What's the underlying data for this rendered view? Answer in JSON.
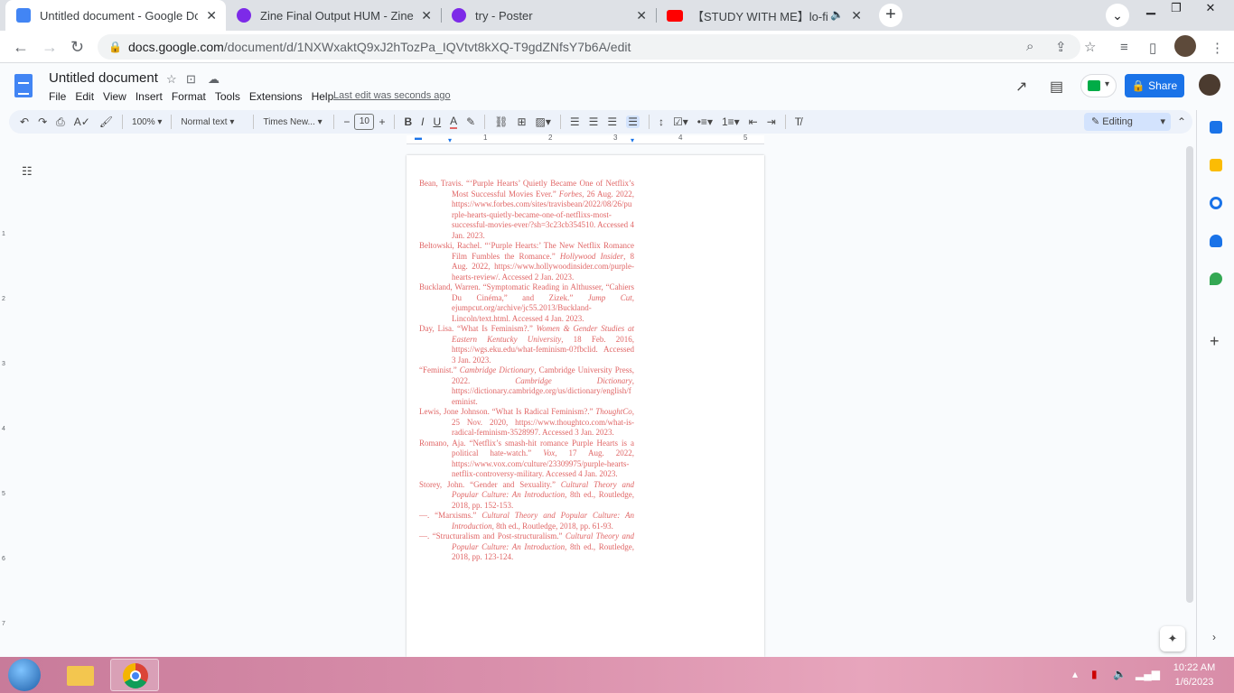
{
  "browser": {
    "tabs": [
      {
        "title": "Untitled document - Google Doc",
        "color": "#4285f4"
      },
      {
        "title": "Zine Final Output HUM - Zine",
        "color": "#7d2ae8"
      },
      {
        "title": "try - Poster",
        "color": "#7d2ae8"
      },
      {
        "title": "【STUDY WITH ME】lo-fi pe",
        "color": "#ff0000"
      }
    ],
    "url_host": "docs.google.com",
    "url_path": "/document/d/1NXWxaktQ9xJ2hTozPa_IQVtvt8kXQ-T9gdZNfsY7b6A/edit"
  },
  "doc": {
    "title": "Untitled document",
    "menu": [
      "File",
      "Edit",
      "View",
      "Insert",
      "Format",
      "Tools",
      "Extensions",
      "Help"
    ],
    "last_edit": "Last edit was seconds ago",
    "share_label": "Share"
  },
  "toolbar": {
    "zoom": "100%",
    "style": "Normal text",
    "font": "Times New...",
    "font_size": "10",
    "mode": "Editing"
  },
  "ruler": {
    "h_labels": [
      "1",
      "2",
      "3",
      "4",
      "5"
    ],
    "v_labels": [
      "1",
      "2",
      "3",
      "4",
      "5",
      "6",
      "7"
    ]
  },
  "references": [
    "Bean, Travis. “‘Purple Hearts’ Quietly Became One of Netflix’s Most Successful Movies Ever.” <i>Forbes</i>, 26 Aug. 2022, https://www.forbes.com/sites/travisbean/2022/08/26/purple-hearts-quietly-became-one-of-netflixs-most-successful-movies-ever/?sh=3c23cb354510. Accessed 4 Jan. 2023.",
    "Beltowski, Rachel. “‘Purple Hearts:’ The New Netflix Romance Film Fumbles the Romance.” <i>Hollywood Insider</i>, 8 Aug. 2022, https://www.hollywoodinsider.com/purple-hearts-review/. Accessed 2 Jan. 2023.",
    "Buckland, Warren. “Symptomatic Reading in Althusser, “Cahiers Du Cinéma,” and Zizek.” <i>Jump Cut</i>, ejumpcut.org/archive/jc55.2013/Buckland-Lincoln/text.html. Accessed 4 Jan. 2023.",
    "Day, Lisa. “What Is Feminism?.” <i>Women &amp; Gender Studies at Eastern Kentucky University</i>, 18 Feb. 2016, https://wgs.eku.edu/what-feminism-0?fbclid. Accessed 3 Jan. 2023.",
    "“Feminist.” <i>Cambridge Dictionary</i>, Cambridge University Press, 2022. <i>Cambridge Dictionary</i>, https://dictionary.cambridge.org/us/dictionary/english/feminist.",
    "Lewis, Jone Johnson. “What Is Radical Feminism?.” <i>ThoughtCo</i>, 25 Nov. 2020, https://www.thoughtco.com/what-is-radical-feminism-3528997. Accessed 3 Jan. 2023.",
    "Romano, Aja. “Netflix’s smash-hit romance Purple Hearts is a political hate-watch.” <i>Vox</i>, 17 Aug. 2022, https://www.vox.com/culture/23309975/purple-hearts-netflix-controversy-military. Accessed 4 Jan. 2023.",
    "Storey, John. “Gender and Sexuality.” <i>Cultural Theory and Popular Culture: An Introduction</i>, 8th ed., Routledge, 2018, pp. 152-153.",
    "—. “Marxisms.” <i>Cultural Theory and Popular Culture: An Introduction</i>, 8th ed., Routledge, 2018, pp. 61-93.",
    "—. “Structuralism and Post-structuralism.” <i>Cultural Theory and Popular Culture: An Introduction</i>, 8th ed., Routledge, 2018, pp. 123-124."
  ],
  "taskbar": {
    "time": "10:22 AM",
    "date": "1/6/2023"
  }
}
